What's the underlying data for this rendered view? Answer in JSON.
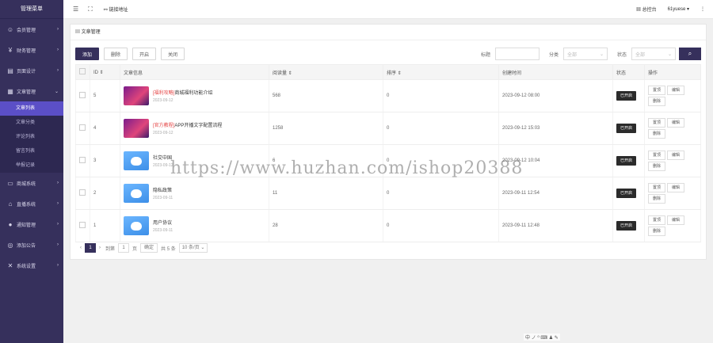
{
  "sidebar": {
    "title": "管理菜单",
    "items": [
      {
        "label": "会员管理",
        "icon": "user-icon"
      },
      {
        "label": "财务管理",
        "icon": "yen-icon"
      },
      {
        "label": "页面设计",
        "icon": "layout-icon"
      },
      {
        "label": "文章管理",
        "icon": "document-icon"
      }
    ],
    "subitems": [
      {
        "label": "文章列表",
        "active": true
      },
      {
        "label": "文章分类"
      },
      {
        "label": "评论列表"
      },
      {
        "label": "留言列表"
      },
      {
        "label": "举报记录"
      }
    ],
    "items2": [
      {
        "label": "商城系统",
        "icon": "store-icon"
      },
      {
        "label": "直播系统",
        "icon": "broadcast-icon"
      },
      {
        "label": "通知管理",
        "icon": "bell-icon"
      },
      {
        "label": "添加公告",
        "icon": "announcement-icon"
      },
      {
        "label": "系统设置",
        "icon": "settings-icon"
      }
    ]
  },
  "topbar": {
    "link_label": "链接地址",
    "console_label": "总控台",
    "user": "61yuese"
  },
  "panel": {
    "title": "文章管理",
    "toolbar": {
      "add": "添加",
      "delete": "删除",
      "open": "开启",
      "close": "关闭"
    },
    "filters": {
      "title_label": "标题",
      "category_label": "分类",
      "category_placeholder": "全部",
      "status_label": "状态",
      "status_placeholder": "全部"
    },
    "columns": [
      "ID",
      "文章信息",
      "阅读量",
      "排序",
      "创建时间",
      "状态",
      "操作"
    ],
    "rows": [
      {
        "id": "5",
        "thumb": "a",
        "tag": "[福利攻略]",
        "title": "商城福利功能介绍",
        "date": "2023-09-12",
        "views": "568",
        "order": "0",
        "created": "2023-09-12 08:00",
        "status": "已开启",
        "ops": [
          "置顶",
          "编辑",
          "删除"
        ]
      },
      {
        "id": "4",
        "thumb": "a",
        "tag": "[官方教程]",
        "title": "APP开播文字配置流程",
        "date": "2023-09-12",
        "views": "1258",
        "order": "0",
        "created": "2023-09-12 15:03",
        "status": "已开启",
        "ops": [
          "置顶",
          "编辑",
          "删除"
        ]
      },
      {
        "id": "3",
        "thumb": "b",
        "tag": "",
        "title": "社交中国",
        "date": "2023-09-12",
        "views": "6",
        "order": "0",
        "created": "2023-09-12 10:04",
        "status": "已开启",
        "ops": [
          "置顶",
          "编辑",
          "删除"
        ]
      },
      {
        "id": "2",
        "thumb": "b",
        "tag": "",
        "title": "隐私政策",
        "date": "2023-09-11",
        "views": "11",
        "order": "0",
        "created": "2023-09-11 12:54",
        "status": "已开启",
        "ops": [
          "置顶",
          "编辑",
          "删除"
        ]
      },
      {
        "id": "1",
        "thumb": "b",
        "tag": "",
        "title": "用户协议",
        "date": "2023-09-11",
        "views": "28",
        "order": "0",
        "created": "2023-09-11 12:48",
        "status": "已开启",
        "ops": [
          "置顶",
          "编辑",
          "删除"
        ]
      }
    ],
    "pager": {
      "current": "1",
      "goto_label": "到第",
      "page_input": "1",
      "page_unit": "页",
      "go": "确定",
      "total": "共 5 条",
      "page_size": "10 条/页"
    }
  },
  "watermark": "https://www.huzhan.com/ishop20388",
  "tray": "中 ノ ⁰ ⌨ ♟ ✎"
}
